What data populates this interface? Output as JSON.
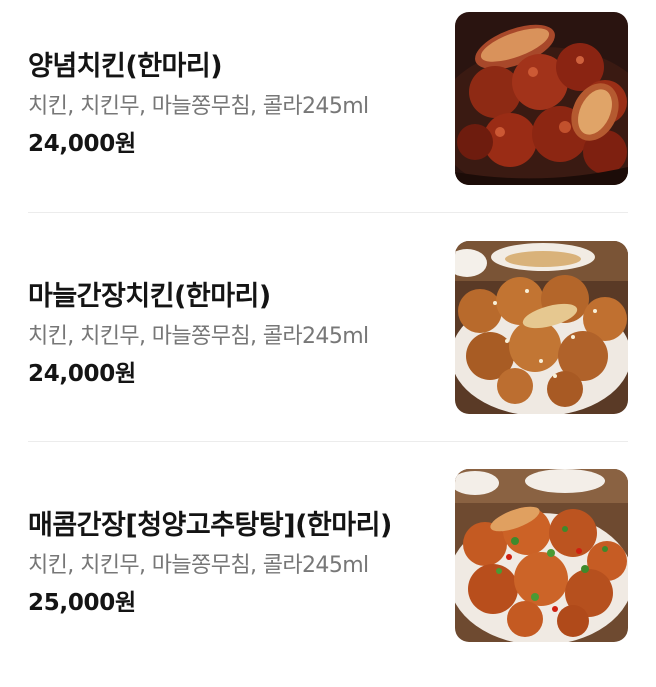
{
  "menu": {
    "items": [
      {
        "name": "양념치킨(한마리)",
        "description": "치킨, 치킨무, 마늘쫑무침, 콜라245ml",
        "price": "24,000원"
      },
      {
        "name": "마늘간장치킨(한마리)",
        "description": "치킨, 치킨무, 마늘쫑무침, 콜라245ml",
        "price": "24,000원"
      },
      {
        "name": "매콤간장[청양고추탕탕](한마리)",
        "description": "치킨, 치킨무, 마늘쫑무침, 콜라245ml",
        "price": "25,000원"
      }
    ]
  },
  "colors": {
    "divider": "#ececec",
    "description_text": "#777777",
    "title_text": "#141414"
  },
  "icons": {
    "thumbnails": [
      "yangnyeom-chicken-photo",
      "garlic-soy-chicken-photo",
      "spicy-soy-chicken-photo"
    ]
  }
}
